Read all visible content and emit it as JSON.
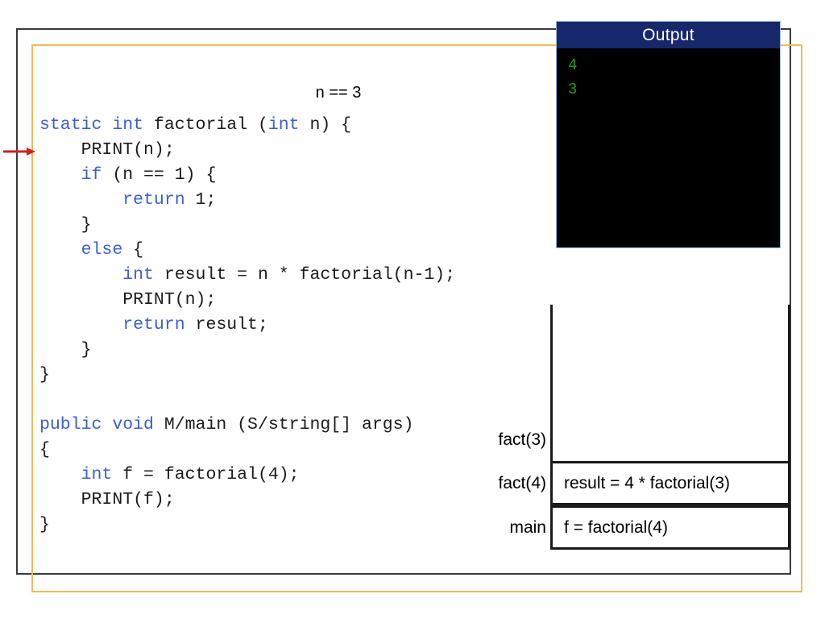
{
  "slide": {
    "annotation": "n == 3",
    "colors": {
      "keyword_blue": "#3a5fcd",
      "frame_gold": "#ebbd51",
      "frame_dark": "#3a3a3a",
      "console_title_navy": "#16276b",
      "console_text_green": "#14a014",
      "arrow_red": "#d41f1f"
    }
  },
  "code": {
    "lines": [
      [
        {
          "t": "static int",
          "k": true
        },
        {
          "t": " factorial (",
          "k": false
        },
        {
          "t": "int",
          "k": true
        },
        {
          "t": " n) {",
          "k": false
        }
      ],
      [
        {
          "t": "    PRINT(n);",
          "k": false
        }
      ],
      [
        {
          "t": "    ",
          "k": false
        },
        {
          "t": "if",
          "k": true
        },
        {
          "t": " (n == 1) {",
          "k": false
        }
      ],
      [
        {
          "t": "        ",
          "k": false
        },
        {
          "t": "return",
          "k": true
        },
        {
          "t": " 1;",
          "k": false
        }
      ],
      [
        {
          "t": "    }",
          "k": false
        }
      ],
      [
        {
          "t": "    ",
          "k": false
        },
        {
          "t": "else",
          "k": true
        },
        {
          "t": " {",
          "k": false
        }
      ],
      [
        {
          "t": "        ",
          "k": false
        },
        {
          "t": "int",
          "k": true
        },
        {
          "t": " result = n * factorial(n-1);",
          "k": false
        }
      ],
      [
        {
          "t": "        PRINT(n);",
          "k": false
        }
      ],
      [
        {
          "t": "        ",
          "k": false
        },
        {
          "t": "return",
          "k": true
        },
        {
          "t": " result;",
          "k": false
        }
      ],
      [
        {
          "t": "    }",
          "k": false
        }
      ],
      [
        {
          "t": "}",
          "k": false
        }
      ],
      [
        {
          "t": "",
          "k": false
        }
      ],
      [
        {
          "t": "public void",
          "k": true
        },
        {
          "t": " M/main (S/string[] args)",
          "k": false
        }
      ],
      [
        {
          "t": "{",
          "k": false
        }
      ],
      [
        {
          "t": "    ",
          "k": false
        },
        {
          "t": "int",
          "k": true
        },
        {
          "t": " f = factorial(4);",
          "k": false
        }
      ],
      [
        {
          "t": "    PRINT(f);",
          "k": false
        }
      ],
      [
        {
          "t": "}",
          "k": false
        }
      ]
    ]
  },
  "output": {
    "title": "Output",
    "lines": [
      "4",
      "3"
    ]
  },
  "callstack": {
    "frames": [
      {
        "label": "fact(3)",
        "body": ""
      },
      {
        "label": "fact(4)",
        "body": "result = 4 * factorial(3)"
      },
      {
        "label": "main",
        "body": "f = factorial(4)"
      }
    ]
  }
}
